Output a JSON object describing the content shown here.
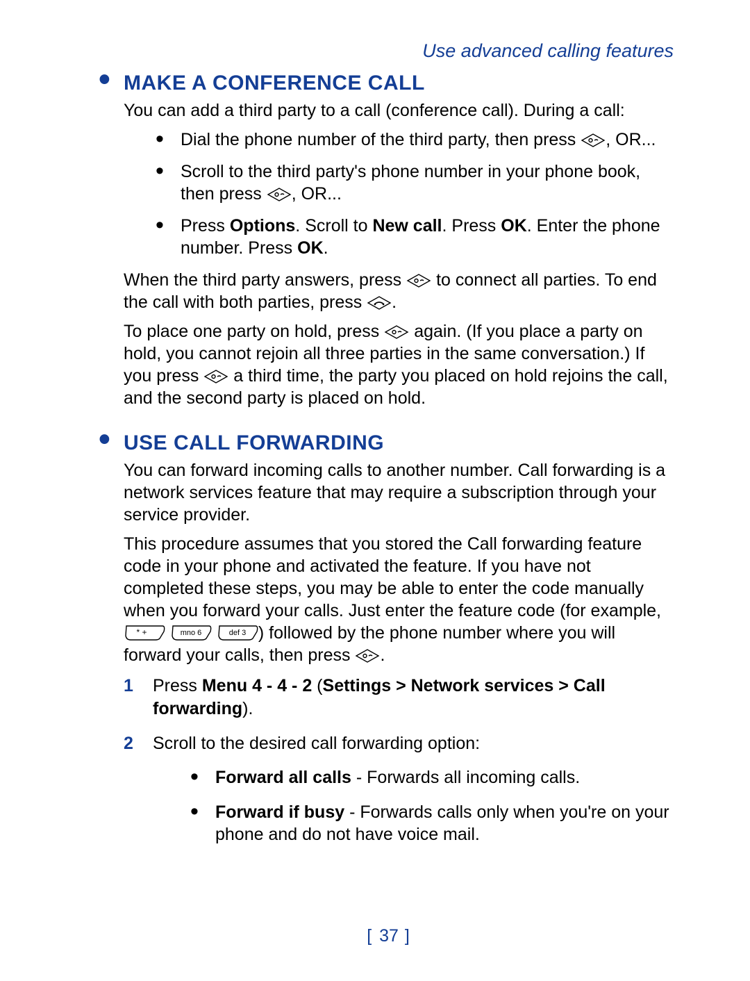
{
  "header": {
    "section": "Use advanced calling features"
  },
  "section1": {
    "title": "MAKE A CONFERENCE CALL",
    "intro": "You can add a third party to a call (conference call). During a call:",
    "bullets": {
      "b1_pre": "Dial the phone number of the third party, then press ",
      "b1_post": ", OR...",
      "b2_pre": "Scroll to the third party's phone number in your phone book, then press ",
      "b2_post": ", OR...",
      "b3_a": "Press ",
      "b3_b": "Options",
      "b3_c": ". Scroll to ",
      "b3_d": "New call",
      "b3_e": ". Press ",
      "b3_f": "OK",
      "b3_g": ". Enter the phone number. Press ",
      "b3_h": "OK",
      "b3_i": "."
    },
    "p2_a": "When the third party answers, press ",
    "p2_b": " to connect all parties. To end the call with both parties, press ",
    "p2_c": ".",
    "p3_a": "To place one party on hold, press ",
    "p3_b": " again. (If you place a party on hold, you cannot rejoin all three parties in the same conversation.) If you press ",
    "p3_c": " a third time, the party you placed on hold rejoins the call, and the second party is placed on hold."
  },
  "section2": {
    "title": "USE CALL FORWARDING",
    "p1": "You can forward incoming calls to another number. Call forwarding is a network services feature that may require a subscription through your service provider.",
    "p2_a": "This procedure assumes that you stored the Call forwarding feature code in your phone and activated the feature. If you have not completed these steps, you may be able to enter the code manually when you forward your calls. Just enter the feature code (for example, ",
    "p2_b": ") followed by the phone number where you will forward your calls, then press ",
    "p2_c": ".",
    "steps": {
      "s1_a": "Press ",
      "s1_b": "Menu 4 - 4 - 2",
      "s1_c": " (",
      "s1_d": "Settings > Network services > Call forwarding",
      "s1_e": ").",
      "s2": "Scroll to the desired call forwarding option:"
    },
    "options": {
      "o1_a": "Forward all calls",
      "o1_b": " - Forwards all incoming calls.",
      "o2_a": "Forward if busy",
      "o2_b": " - Forwards calls only when you're on your phone and do not have voice mail."
    }
  },
  "keys": {
    "star": "* +",
    "six": "mno 6",
    "three": "def 3"
  },
  "footer": {
    "page": "37"
  }
}
